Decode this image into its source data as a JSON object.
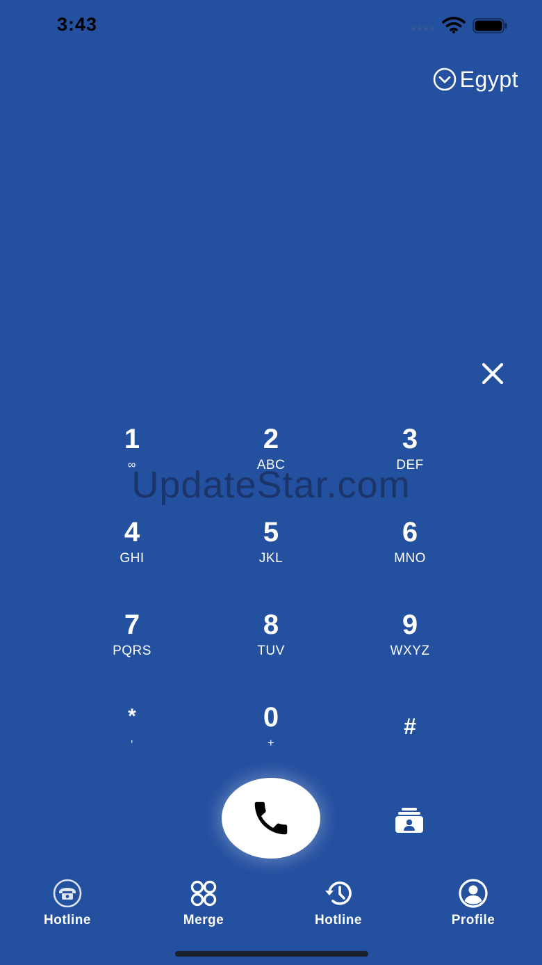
{
  "status_bar": {
    "time": "3:43",
    "icons": [
      "signal-dots-icon",
      "wifi-icon",
      "battery-icon"
    ]
  },
  "country": {
    "name": "Egypt",
    "icon": "chevron-down-circle-icon"
  },
  "number_display": {
    "value": ""
  },
  "keypad": {
    "keys": [
      {
        "digit": "1",
        "letters": "∞"
      },
      {
        "digit": "2",
        "letters": "ABC"
      },
      {
        "digit": "3",
        "letters": "DEF"
      },
      {
        "digit": "4",
        "letters": "GHI"
      },
      {
        "digit": "5",
        "letters": "JKL"
      },
      {
        "digit": "6",
        "letters": "MNO"
      },
      {
        "digit": "7",
        "letters": "PQRS"
      },
      {
        "digit": "8",
        "letters": "TUV"
      },
      {
        "digit": "9",
        "letters": "WXYZ"
      },
      {
        "digit": "*",
        "letters": ","
      },
      {
        "digit": "0",
        "letters": "+"
      },
      {
        "digit": "#",
        "letters": ""
      }
    ]
  },
  "watermark": "UpdateStar.com",
  "actions": {
    "clear_icon": "close-icon",
    "call_icon": "phone-icon",
    "contacts_icon": "contacts-card-icon"
  },
  "tabs": [
    {
      "label": "Hotline",
      "icon": "telephone-icon"
    },
    {
      "label": "Merge",
      "icon": "grid-circles-icon"
    },
    {
      "label": "Hotline",
      "icon": "history-clock-icon"
    },
    {
      "label": "Profile",
      "icon": "user-circle-icon"
    }
  ],
  "colors": {
    "background": "#2450a0",
    "foreground": "#ffffff",
    "call_button": "#ffffff",
    "status_text": "#000000"
  }
}
